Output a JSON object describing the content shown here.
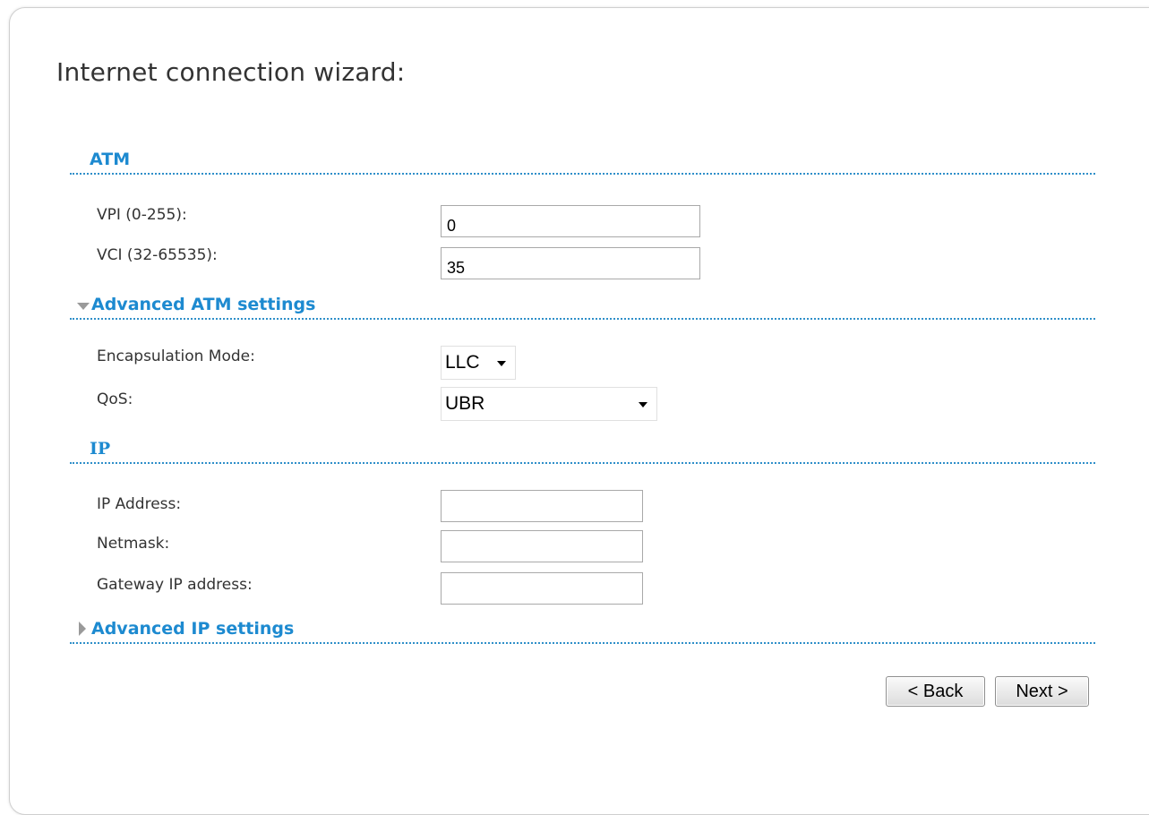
{
  "wizard": {
    "title": "Internet connection wizard:"
  },
  "atm": {
    "heading": "ATM",
    "vpi_label": "VPI (0-255):",
    "vpi_value": "0",
    "vci_label": "VCI (32-65535):",
    "vci_value": "35"
  },
  "advanced_atm": {
    "heading": "Advanced ATM settings",
    "expanded": true,
    "encapsulation_label": "Encapsulation Mode:",
    "encapsulation_value": "LLC",
    "qos_label": "QoS:",
    "qos_value": "UBR"
  },
  "ip": {
    "heading": "IP",
    "address_label": "IP Address:",
    "address_value": "",
    "netmask_label": "Netmask:",
    "netmask_value": "",
    "gateway_label": "Gateway IP address:",
    "gateway_value": ""
  },
  "advanced_ip": {
    "heading": "Advanced IP settings",
    "expanded": false
  },
  "buttons": {
    "back": "< Back",
    "next": "Next >"
  },
  "colors": {
    "accent": "#1d8ad0",
    "divider": "#2f8fc9",
    "text": "#333333"
  }
}
